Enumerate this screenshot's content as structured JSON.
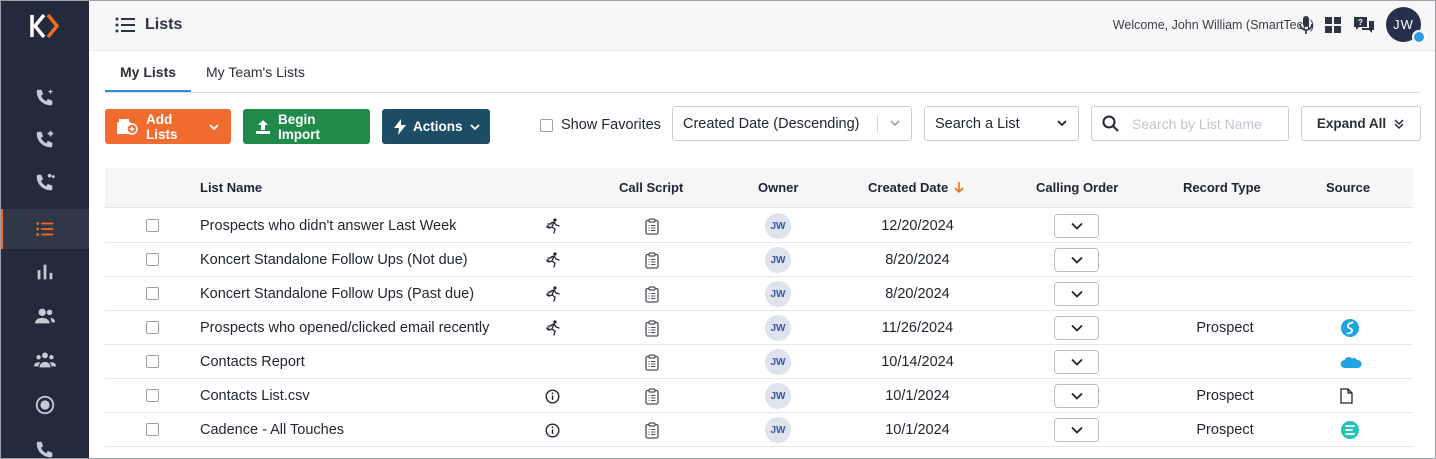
{
  "app": {
    "page_title": "Lists",
    "welcome_text": "Welcome, John William (SmartTech)",
    "user_initials": "JW",
    "brand_color": "#f26b21"
  },
  "sidebar": {
    "items": [
      {
        "icon": "phone-sparkle-icon",
        "active": false
      },
      {
        "icon": "phone-plus-icon",
        "active": false
      },
      {
        "icon": "phone-users-icon",
        "active": false
      },
      {
        "icon": "list-icon",
        "active": true
      },
      {
        "icon": "bar-chart-icon",
        "active": false
      },
      {
        "icon": "user-group-icon",
        "active": false
      },
      {
        "icon": "team-icon",
        "active": false
      },
      {
        "icon": "record-icon",
        "active": false
      },
      {
        "icon": "phone-transfer-icon",
        "active": false
      }
    ]
  },
  "tabs": [
    {
      "label": "My Lists",
      "active": true
    },
    {
      "label": "My Team's Lists",
      "active": false
    }
  ],
  "toolbar": {
    "add_lists": "Add Lists",
    "begin_import": "Begin Import",
    "actions": "Actions",
    "show_favorites": "Show Favorites",
    "sort_value": "Created Date (Descending)",
    "list_select_value": "Search a List",
    "search_placeholder": "Search by List Name",
    "expand_all": "Expand All",
    "colors": {
      "add": "#f26b2f",
      "import": "#208a4b",
      "actions": "#1c4c66"
    }
  },
  "table": {
    "columns": [
      "List Name",
      "Call Script",
      "Owner",
      "Created Date",
      "Calling Order",
      "Record Type",
      "Source"
    ],
    "rows": [
      {
        "name": "Prospects who didn't answer Last Week",
        "status_icon": "runner-icon",
        "owner": "JW",
        "created": "12/20/2024",
        "record_type": "",
        "source": ""
      },
      {
        "name": "Koncert Standalone Follow Ups (Not due)",
        "status_icon": "runner-icon",
        "owner": "JW",
        "created": "8/20/2024",
        "record_type": "",
        "source": ""
      },
      {
        "name": "Koncert Standalone Follow Ups (Past due)",
        "status_icon": "runner-icon",
        "owner": "JW",
        "created": "8/20/2024",
        "record_type": "",
        "source": ""
      },
      {
        "name": "Prospects who opened/clicked email recently",
        "status_icon": "runner-icon",
        "owner": "JW",
        "created": "11/26/2024",
        "record_type": "Prospect",
        "source": "salesloft-icon"
      },
      {
        "name": "Contacts Report",
        "status_icon": "",
        "owner": "JW",
        "created": "10/14/2024",
        "record_type": "",
        "source": "salesforce-icon"
      },
      {
        "name": "Contacts List.csv",
        "status_icon": "info-icon",
        "owner": "JW",
        "created": "10/1/2024",
        "record_type": "Prospect",
        "source": "file-icon"
      },
      {
        "name": "Cadence - All Touches",
        "status_icon": "info-icon",
        "owner": "JW",
        "created": "10/1/2024",
        "record_type": "Prospect",
        "source": "koncert-cadence-icon"
      }
    ]
  }
}
